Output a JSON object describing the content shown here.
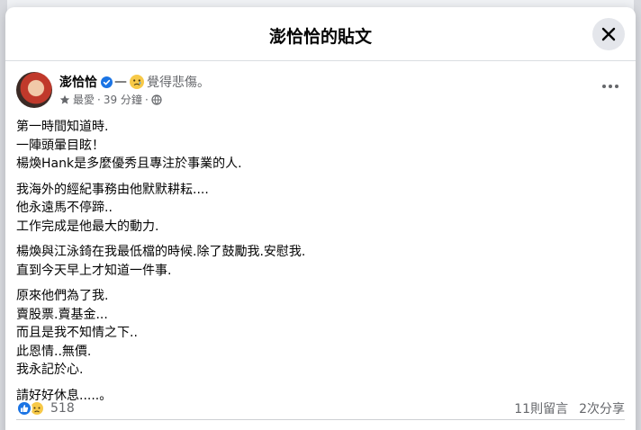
{
  "modal": {
    "title": "澎恰恰的貼文"
  },
  "post": {
    "author": "澎恰恰",
    "feeling_prefix": "—",
    "feeling": "覺得悲傷。",
    "audience": "最愛",
    "time": "39 分鐘",
    "body": [
      [
        "第一時間知道時.",
        "一陣頭暈目眩！",
        "楊煥Hank是多麼優秀且專注於事業的人."
      ],
      [
        "我海外的經紀事務由他默默耕耘....",
        "他永遠馬不停蹄..",
        "工作完成是他最大的動力."
      ],
      [
        "楊煥與江泳錡在我最低檔的時候.除了鼓勵我.安慰我.",
        "直到今天早上才知道一件事."
      ],
      [
        "原來他們為了我.",
        "賣股票.賣基金...",
        "而且是我不知情之下..",
        "此恩情..無價.",
        "我永記於心."
      ],
      [
        "請好好休息.....。"
      ]
    ]
  },
  "stats": {
    "reaction_count": "518",
    "comments": "11則留言",
    "shares": "2次分享"
  },
  "colors": {
    "primary_blue": "#1b74e4",
    "secondary_text": "#65676b",
    "sad_yellow": "#f7c948"
  },
  "icons": [
    "close-icon",
    "verified-icon",
    "sad-emoji-icon",
    "star-icon",
    "globe-icon",
    "more-icon",
    "like-reaction-icon",
    "sad-reaction-icon"
  ]
}
